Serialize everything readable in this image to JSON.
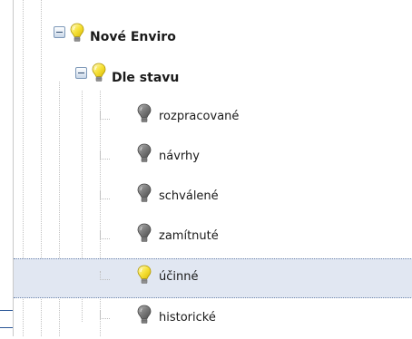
{
  "tree": {
    "root": {
      "label": "Nové Enviro",
      "expanded": true,
      "icon": "lightbulb-on-icon"
    },
    "group": {
      "label": "Dle stavu",
      "expanded": true,
      "icon": "lightbulb-on-icon"
    },
    "items": [
      {
        "label": "rozpracované",
        "icon": "lightbulb-off-icon",
        "selected": false
      },
      {
        "label": "návrhy",
        "icon": "lightbulb-off-icon",
        "selected": false
      },
      {
        "label": "schválené",
        "icon": "lightbulb-off-icon",
        "selected": false
      },
      {
        "label": "zamítnuté",
        "icon": "lightbulb-off-icon",
        "selected": false
      },
      {
        "label": "účinné",
        "icon": "lightbulb-on-icon",
        "selected": true
      },
      {
        "label": "historické",
        "icon": "lightbulb-off-icon",
        "selected": false
      }
    ]
  },
  "colors": {
    "selection": "#e1e7f2",
    "bulb_on": "#f5d817",
    "bulb_off": "#7a7a7a"
  }
}
